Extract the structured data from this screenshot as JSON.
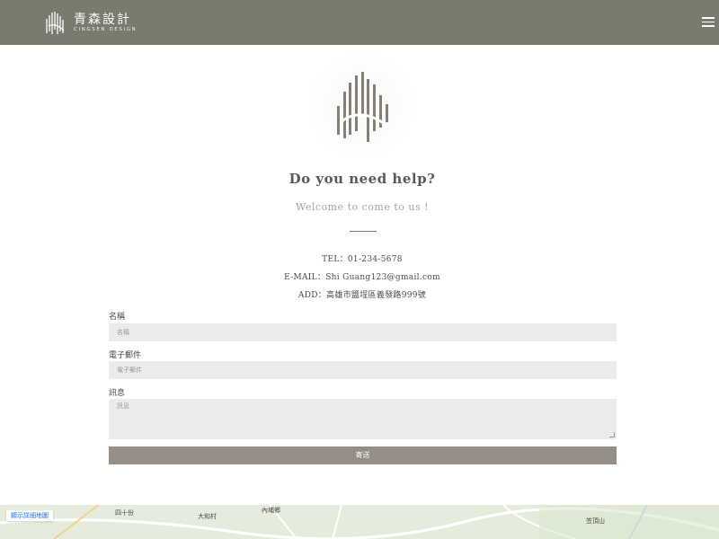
{
  "header": {
    "brand_cn": "青森設計",
    "brand_en": "CINGSEN DESIGN",
    "bg_color": "#7a7a6e"
  },
  "hero": {
    "title": "Do you need help?",
    "subtitle": "Welcome to come to us !"
  },
  "contact": {
    "tel": "TEL：01-234-5678",
    "email": "E-MAIL：Shi Guang123@gmail.com",
    "address": "ADD：高雄市鹽埕區義發路999號"
  },
  "form": {
    "name_label": "名稱",
    "name_placeholder": "名稱",
    "email_label": "電子郵件",
    "email_placeholder": "電子郵件",
    "message_label": "訊息",
    "message_placeholder": "訊息",
    "submit_label": "寄送"
  },
  "map": {
    "view_larger_label": "顯示詳細地圖",
    "place_labels": [
      "四十份",
      "大和村",
      "內埔鄉",
      "笠頂山"
    ]
  },
  "icons": [
    "logo-icon",
    "menu-icon",
    "emblem-icon"
  ]
}
